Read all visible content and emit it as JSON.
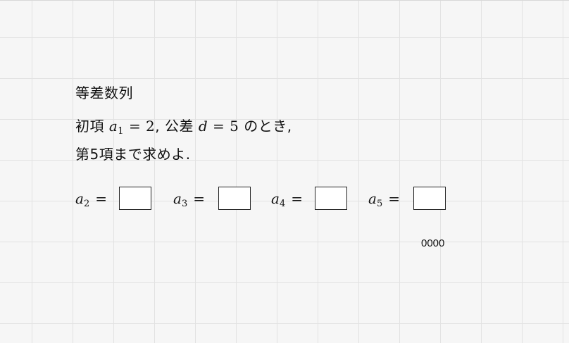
{
  "title": "等差数列",
  "problem": {
    "line1_prefix": "初項",
    "a_var": "a",
    "a_sub": "1",
    "a_eq": "= 2",
    "comma1": ",",
    "diff_label": "公差",
    "d_var": "d",
    "d_eq": "= 5",
    "line1_suffix": "のとき,",
    "line2": "第5項まで求めよ."
  },
  "answers": [
    {
      "var": "a",
      "sub": "2",
      "eq": "="
    },
    {
      "var": "a",
      "sub": "3",
      "eq": "="
    },
    {
      "var": "a",
      "sub": "4",
      "eq": "="
    },
    {
      "var": "a",
      "sub": "5",
      "eq": "="
    }
  ],
  "footer_code": "0000"
}
